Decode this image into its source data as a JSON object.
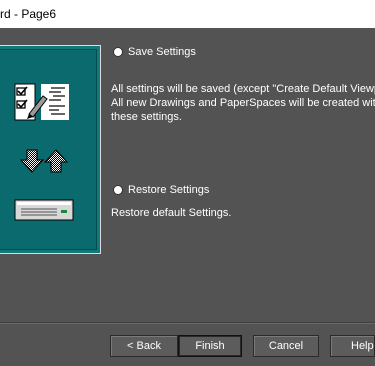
{
  "window": {
    "title": "rd - Page6"
  },
  "options": {
    "save": {
      "label": "Save Settings",
      "desc1": "All settings will be saved (except \"Create Default Viewpo",
      "desc2": "All new Drawings and PaperSpaces will be created with",
      "desc3": "these settings."
    },
    "restore": {
      "label": "Restore Settings",
      "desc1": "Restore default Settings."
    }
  },
  "buttons": {
    "back": "< Back",
    "finish": "Finish",
    "cancel": "Cancel",
    "help": "Help"
  },
  "colors": {
    "background": "#535353",
    "graphic_panel": "#0f7a7d"
  },
  "icons": [
    "checklist-pen-icon",
    "up-down-arrows-icon",
    "storage-device-icon"
  ]
}
